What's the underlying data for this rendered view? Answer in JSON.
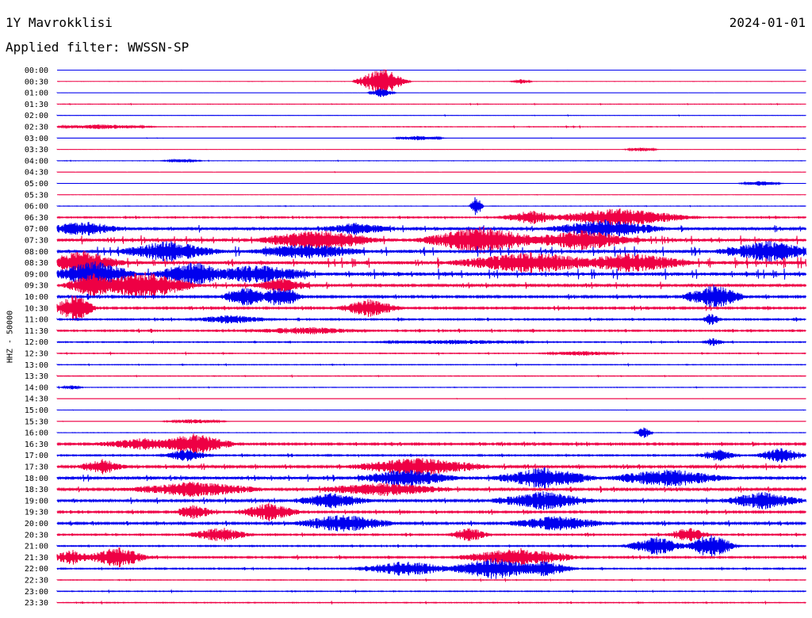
{
  "header": {
    "station": "1Y Mavrokklisi",
    "date": "2024-01-01",
    "filter_prefix": "Applied filter:",
    "filter_name": "WWSSN-SP"
  },
  "channel_label": "HHZ - 50000",
  "colors": {
    "trace_a": "#0000ee",
    "trace_b": "#ee0044",
    "text": "#000000",
    "background": "#ffffff"
  },
  "chart_data": {
    "type": "line",
    "title": "1Y Mavrokklisi",
    "ylabel": "HHZ - 50000",
    "x_range_minutes": [
      0,
      30
    ],
    "grid": false,
    "series_color_cycle": [
      "#0000ee",
      "#ee0044"
    ],
    "rows": [
      {
        "label": "00:00",
        "activity": 0.05,
        "events": []
      },
      {
        "label": "00:30",
        "activity": 0.06,
        "events": [
          {
            "minute": 13.0,
            "amplitude": 18,
            "width": 1.2
          },
          {
            "minute": 18.6,
            "amplitude": 3,
            "width": 0.5
          }
        ]
      },
      {
        "label": "01:00",
        "activity": 0.12,
        "events": [
          {
            "minute": 13.0,
            "amplitude": 6,
            "width": 0.6
          }
        ]
      },
      {
        "label": "01:30",
        "activity": 0.2,
        "events": []
      },
      {
        "label": "02:00",
        "activity": 0.2,
        "events": []
      },
      {
        "label": "02:30",
        "activity": 0.3,
        "events": [
          {
            "minute": 1.8,
            "amplitude": 3,
            "width": 2.5
          }
        ]
      },
      {
        "label": "03:00",
        "activity": 0.15,
        "events": [
          {
            "minute": 14.5,
            "amplitude": 3,
            "width": 1.2
          }
        ]
      },
      {
        "label": "03:30",
        "activity": 0.1,
        "events": [
          {
            "minute": 23.4,
            "amplitude": 2.5,
            "width": 0.8
          }
        ]
      },
      {
        "label": "04:00",
        "activity": 0.18,
        "events": [
          {
            "minute": 5.0,
            "amplitude": 2,
            "width": 1.0
          }
        ]
      },
      {
        "label": "04:30",
        "activity": 0.12,
        "events": []
      },
      {
        "label": "05:00",
        "activity": 0.12,
        "events": [
          {
            "minute": 28.2,
            "amplitude": 3,
            "width": 1.0
          }
        ]
      },
      {
        "label": "05:30",
        "activity": 0.1,
        "events": []
      },
      {
        "label": "06:00",
        "activity": 0.2,
        "events": [
          {
            "minute": 16.8,
            "amplitude": 14,
            "width": 0.3
          }
        ]
      },
      {
        "label": "06:30",
        "activity": 0.6,
        "events": [
          {
            "minute": 19.0,
            "amplitude": 9,
            "width": 1.5
          },
          {
            "minute": 22.5,
            "amplitude": 12,
            "width": 3.5
          }
        ]
      },
      {
        "label": "07:00",
        "activity": 1.3,
        "events": [
          {
            "minute": 1.0,
            "amplitude": 10,
            "width": 2.0
          },
          {
            "minute": 12.0,
            "amplitude": 8,
            "width": 2.0
          },
          {
            "minute": 22.0,
            "amplitude": 12,
            "width": 3.0
          }
        ]
      },
      {
        "label": "07:30",
        "activity": 1.6,
        "events": [
          {
            "minute": 10.5,
            "amplitude": 14,
            "width": 3.0
          },
          {
            "minute": 17.0,
            "amplitude": 18,
            "width": 3.0
          },
          {
            "minute": 21.0,
            "amplitude": 13,
            "width": 3.0
          }
        ]
      },
      {
        "label": "08:00",
        "activity": 1.8,
        "events": [
          {
            "minute": 4.5,
            "amplitude": 14,
            "width": 2.5
          },
          {
            "minute": 10.0,
            "amplitude": 10,
            "width": 3.0
          },
          {
            "minute": 28.5,
            "amplitude": 14,
            "width": 2.5
          }
        ]
      },
      {
        "label": "08:30",
        "activity": 1.9,
        "events": [
          {
            "minute": 1.0,
            "amplitude": 16,
            "width": 2.0
          },
          {
            "minute": 19.0,
            "amplitude": 14,
            "width": 4.0
          },
          {
            "minute": 23.0,
            "amplitude": 13,
            "width": 3.0
          }
        ]
      },
      {
        "label": "09:00",
        "activity": 1.9,
        "events": [
          {
            "minute": 1.5,
            "amplitude": 18,
            "width": 2.0
          },
          {
            "minute": 5.5,
            "amplitude": 16,
            "width": 2.0
          },
          {
            "minute": 8.0,
            "amplitude": 12,
            "width": 3.0
          }
        ]
      },
      {
        "label": "09:30",
        "activity": 1.2,
        "events": [
          {
            "minute": 1.5,
            "amplitude": 16,
            "width": 1.5
          },
          {
            "minute": 3.5,
            "amplitude": 18,
            "width": 2.5
          },
          {
            "minute": 9.0,
            "amplitude": 10,
            "width": 1.5
          }
        ]
      },
      {
        "label": "10:00",
        "activity": 1.0,
        "events": [
          {
            "minute": 7.5,
            "amplitude": 14,
            "width": 1.2
          },
          {
            "minute": 9.0,
            "amplitude": 16,
            "width": 1.0
          },
          {
            "minute": 26.3,
            "amplitude": 16,
            "width": 1.5
          }
        ]
      },
      {
        "label": "10:30",
        "activity": 0.9,
        "events": [
          {
            "minute": 0.7,
            "amplitude": 18,
            "width": 1.0
          },
          {
            "minute": 12.5,
            "amplitude": 12,
            "width": 1.5
          }
        ]
      },
      {
        "label": "11:00",
        "activity": 0.7,
        "events": [
          {
            "minute": 7.0,
            "amplitude": 6,
            "width": 2.0
          },
          {
            "minute": 26.2,
            "amplitude": 8,
            "width": 0.5
          }
        ]
      },
      {
        "label": "11:30",
        "activity": 0.7,
        "events": [
          {
            "minute": 10.0,
            "amplitude": 5,
            "width": 3.0
          }
        ]
      },
      {
        "label": "12:00",
        "activity": 0.5,
        "events": [
          {
            "minute": 16.0,
            "amplitude": 3,
            "width": 4.0
          },
          {
            "minute": 26.3,
            "amplitude": 6,
            "width": 0.5
          }
        ]
      },
      {
        "label": "12:30",
        "activity": 0.4,
        "events": [
          {
            "minute": 21.0,
            "amplitude": 3,
            "width": 2.0
          }
        ]
      },
      {
        "label": "13:00",
        "activity": 0.35,
        "events": []
      },
      {
        "label": "13:30",
        "activity": 0.3,
        "events": []
      },
      {
        "label": "14:00",
        "activity": 0.25,
        "events": [
          {
            "minute": 0.6,
            "amplitude": 3,
            "width": 0.5
          }
        ]
      },
      {
        "label": "14:30",
        "activity": 0.15,
        "events": []
      },
      {
        "label": "15:00",
        "activity": 0.1,
        "events": []
      },
      {
        "label": "15:30",
        "activity": 0.15,
        "events": [
          {
            "minute": 5.5,
            "amplitude": 3,
            "width": 1.5
          }
        ]
      },
      {
        "label": "16:00",
        "activity": 0.2,
        "events": [
          {
            "minute": 23.5,
            "amplitude": 8,
            "width": 0.4
          }
        ]
      },
      {
        "label": "16:30",
        "activity": 0.9,
        "events": [
          {
            "minute": 3.5,
            "amplitude": 8,
            "width": 2.5
          },
          {
            "minute": 5.5,
            "amplitude": 14,
            "width": 2.0
          }
        ]
      },
      {
        "label": "17:00",
        "activity": 0.7,
        "events": [
          {
            "minute": 5.2,
            "amplitude": 8,
            "width": 1.2
          },
          {
            "minute": 26.5,
            "amplitude": 8,
            "width": 1.0
          },
          {
            "minute": 29.0,
            "amplitude": 10,
            "width": 1.2
          }
        ]
      },
      {
        "label": "17:30",
        "activity": 1.1,
        "events": [
          {
            "minute": 1.8,
            "amplitude": 10,
            "width": 1.2
          },
          {
            "minute": 14.5,
            "amplitude": 12,
            "width": 3.5
          }
        ]
      },
      {
        "label": "18:00",
        "activity": 1.3,
        "events": [
          {
            "minute": 14.0,
            "amplitude": 12,
            "width": 2.5
          },
          {
            "minute": 19.5,
            "amplitude": 14,
            "width": 2.5
          },
          {
            "minute": 24.5,
            "amplitude": 12,
            "width": 3.0
          }
        ]
      },
      {
        "label": "18:30",
        "activity": 1.2,
        "events": [
          {
            "minute": 5.5,
            "amplitude": 10,
            "width": 3.5
          },
          {
            "minute": 13.0,
            "amplitude": 9,
            "width": 3.5
          }
        ]
      },
      {
        "label": "19:00",
        "activity": 1.2,
        "events": [
          {
            "minute": 11.0,
            "amplitude": 10,
            "width": 2.0
          },
          {
            "minute": 19.5,
            "amplitude": 12,
            "width": 2.5
          },
          {
            "minute": 28.3,
            "amplitude": 12,
            "width": 2.0
          }
        ]
      },
      {
        "label": "19:30",
        "activity": 0.9,
        "events": [
          {
            "minute": 5.5,
            "amplitude": 10,
            "width": 1.0
          },
          {
            "minute": 8.5,
            "amplitude": 12,
            "width": 1.5
          }
        ]
      },
      {
        "label": "20:00",
        "activity": 1.0,
        "events": [
          {
            "minute": 11.5,
            "amplitude": 12,
            "width": 2.5
          },
          {
            "minute": 20.0,
            "amplitude": 10,
            "width": 2.5
          }
        ]
      },
      {
        "label": "20:30",
        "activity": 0.7,
        "events": [
          {
            "minute": 6.5,
            "amplitude": 10,
            "width": 1.5
          },
          {
            "minute": 16.5,
            "amplitude": 10,
            "width": 1.0
          },
          {
            "minute": 25.3,
            "amplitude": 10,
            "width": 1.0
          }
        ]
      },
      {
        "label": "21:00",
        "activity": 0.6,
        "events": [
          {
            "minute": 24.0,
            "amplitude": 12,
            "width": 1.5
          },
          {
            "minute": 26.2,
            "amplitude": 16,
            "width": 1.2
          }
        ]
      },
      {
        "label": "21:30",
        "activity": 0.8,
        "events": [
          {
            "minute": 0.6,
            "amplitude": 10,
            "width": 1.0
          },
          {
            "minute": 2.4,
            "amplitude": 14,
            "width": 1.5
          },
          {
            "minute": 18.5,
            "amplitude": 12,
            "width": 3.0
          }
        ]
      },
      {
        "label": "22:00",
        "activity": 0.6,
        "events": [
          {
            "minute": 14.0,
            "amplitude": 10,
            "width": 2.5
          },
          {
            "minute": 17.5,
            "amplitude": 14,
            "width": 2.5
          },
          {
            "minute": 19.5,
            "amplitude": 10,
            "width": 1.5
          }
        ]
      },
      {
        "label": "22:30",
        "activity": 0.35,
        "events": []
      },
      {
        "label": "23:00",
        "activity": 0.4,
        "events": []
      },
      {
        "label": "23:30",
        "activity": 0.4,
        "events": []
      }
    ]
  }
}
